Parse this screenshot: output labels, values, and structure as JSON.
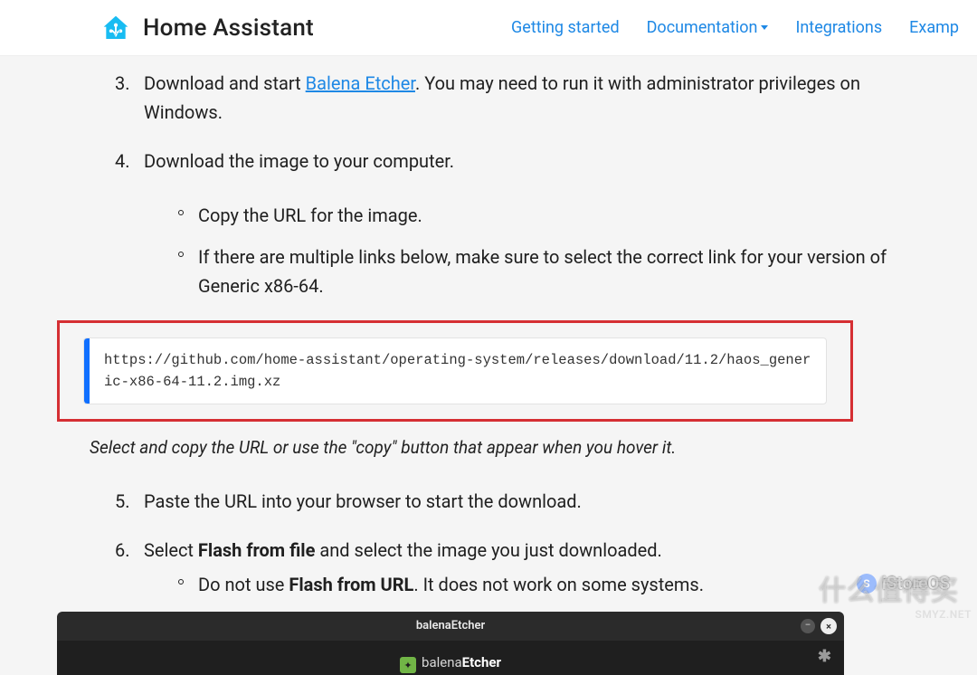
{
  "header": {
    "brand": "Home Assistant",
    "nav": {
      "getting_started": "Getting started",
      "documentation": "Documentation",
      "integrations": "Integrations",
      "examples": "Examp"
    }
  },
  "steps": {
    "s3_num": "3.",
    "s3a": "Download and start ",
    "s3_link": "Balena Etcher",
    "s3b": ". You may need to run it with administrator privileges on Windows.",
    "s4_num": "4.",
    "s4": "Download the image to your computer.",
    "s4_sub1": "Copy the URL for the image.",
    "s4_sub2": "If there are multiple links below, make sure to select the correct link for your version of Generic x86-64.",
    "s5_num": "5.",
    "s5": "Paste the URL into your browser to start the download.",
    "s6_num": "6.",
    "s6a": "Select ",
    "s6_b1": "Flash from file",
    "s6b": " and select the image you just downloaded.",
    "s6_sub_a": "Do not use ",
    "s6_sub_b": "Flash from URL",
    "s6_sub_c": ". It does not work on some systems."
  },
  "code_url": "https://github.com/home-assistant/operating-system/releases/download/11.2/haos_generic-x86-64-11.2.img.xz",
  "caption": "Select and copy the URL or use the \"copy\" button that appear when you hover it.",
  "etcher": {
    "titlebar": "balenaEtcher",
    "logo_a": "balena",
    "logo_b": "Etcher",
    "min": "–",
    "close": "×",
    "gear": "✱"
  },
  "watermarks": {
    "istoreos": "iStoreOS",
    "cn": "什么值得买",
    "smyz": "SMYZ.NET"
  }
}
